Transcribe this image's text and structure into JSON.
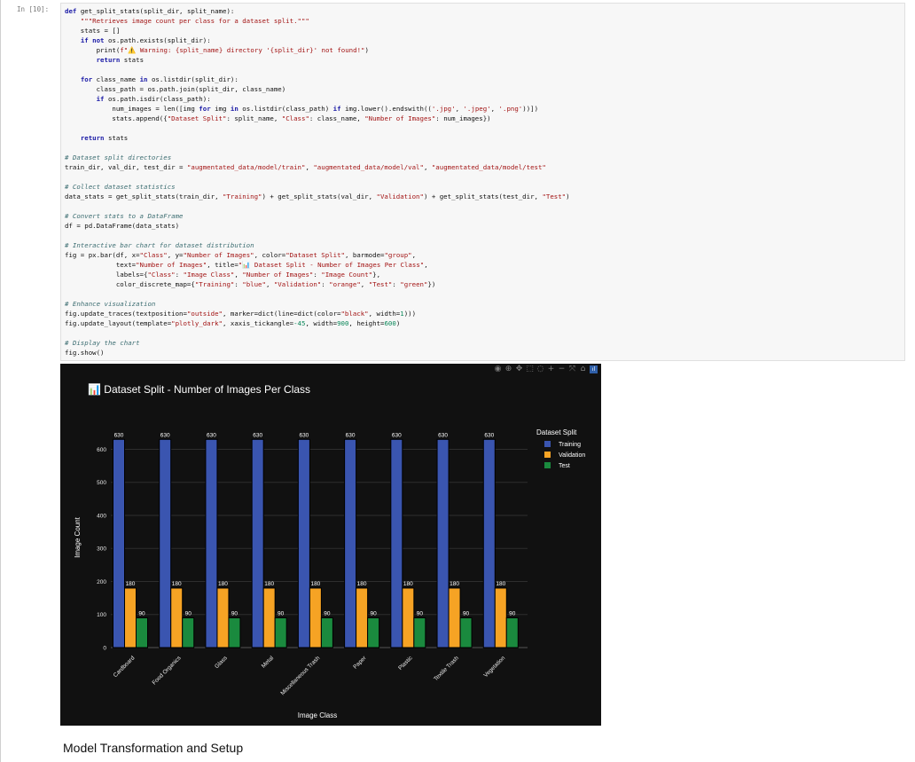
{
  "cell": {
    "prompt": "In [10]:",
    "code_lines": [
      [
        {
          "t": "def ",
          "c": "kw"
        },
        {
          "t": "get_split_stats(split_dir, split_name):",
          "c": "p"
        }
      ],
      [
        {
          "t": "    \"\"\"Retrieves image count per class for a dataset split.\"\"\"",
          "c": "str"
        }
      ],
      [
        {
          "t": "    stats = []",
          "c": "p"
        }
      ],
      [
        {
          "t": "    ",
          "c": "p"
        },
        {
          "t": "if not ",
          "c": "kw"
        },
        {
          "t": "os.path.exists(split_dir):",
          "c": "p"
        }
      ],
      [
        {
          "t": "        print(",
          "c": "p"
        },
        {
          "t": "f\"⚠️ Warning: {split_name} directory '{split_dir}' not found!\"",
          "c": "str"
        },
        {
          "t": ")",
          "c": "p"
        }
      ],
      [
        {
          "t": "        ",
          "c": "p"
        },
        {
          "t": "return ",
          "c": "kw"
        },
        {
          "t": "stats",
          "c": "p"
        }
      ],
      [
        {
          "t": "",
          "c": "p"
        }
      ],
      [
        {
          "t": "    ",
          "c": "p"
        },
        {
          "t": "for ",
          "c": "kw"
        },
        {
          "t": "class_name ",
          "c": "p"
        },
        {
          "t": "in ",
          "c": "kw"
        },
        {
          "t": "os.listdir(split_dir):",
          "c": "p"
        }
      ],
      [
        {
          "t": "        class_path = os.path.join(split_dir, class_name)",
          "c": "p"
        }
      ],
      [
        {
          "t": "        ",
          "c": "p"
        },
        {
          "t": "if ",
          "c": "kw"
        },
        {
          "t": "os.path.isdir(class_path):",
          "c": "p"
        }
      ],
      [
        {
          "t": "            num_images = len([img ",
          "c": "p"
        },
        {
          "t": "for ",
          "c": "kw"
        },
        {
          "t": "img ",
          "c": "p"
        },
        {
          "t": "in ",
          "c": "kw"
        },
        {
          "t": "os.listdir(class_path) ",
          "c": "p"
        },
        {
          "t": "if ",
          "c": "kw"
        },
        {
          "t": "img.lower().endswith((",
          "c": "p"
        },
        {
          "t": "'.jpg'",
          "c": "str"
        },
        {
          "t": ", ",
          "c": "p"
        },
        {
          "t": "'.jpeg'",
          "c": "str"
        },
        {
          "t": ", ",
          "c": "p"
        },
        {
          "t": "'.png'",
          "c": "str"
        },
        {
          "t": "))])",
          "c": "p"
        }
      ],
      [
        {
          "t": "            stats.append({",
          "c": "p"
        },
        {
          "t": "\"Dataset Split\"",
          "c": "str"
        },
        {
          "t": ": split_name, ",
          "c": "p"
        },
        {
          "t": "\"Class\"",
          "c": "str"
        },
        {
          "t": ": class_name, ",
          "c": "p"
        },
        {
          "t": "\"Number of Images\"",
          "c": "str"
        },
        {
          "t": ": num_images})",
          "c": "p"
        }
      ],
      [
        {
          "t": "",
          "c": "p"
        }
      ],
      [
        {
          "t": "    ",
          "c": "p"
        },
        {
          "t": "return ",
          "c": "kw"
        },
        {
          "t": "stats",
          "c": "p"
        }
      ],
      [
        {
          "t": "",
          "c": "p"
        }
      ],
      [
        {
          "t": "# Dataset split directories",
          "c": "cm"
        }
      ],
      [
        {
          "t": "train_dir, val_dir, test_dir = ",
          "c": "p"
        },
        {
          "t": "\"augmentated_data/model/train\"",
          "c": "str"
        },
        {
          "t": ", ",
          "c": "p"
        },
        {
          "t": "\"augmentated_data/model/val\"",
          "c": "str"
        },
        {
          "t": ", ",
          "c": "p"
        },
        {
          "t": "\"augmentated_data/model/test\"",
          "c": "str"
        }
      ],
      [
        {
          "t": "",
          "c": "p"
        }
      ],
      [
        {
          "t": "# Collect dataset statistics",
          "c": "cm"
        }
      ],
      [
        {
          "t": "data_stats = get_split_stats(train_dir, ",
          "c": "p"
        },
        {
          "t": "\"Training\"",
          "c": "str"
        },
        {
          "t": ") + get_split_stats(val_dir, ",
          "c": "p"
        },
        {
          "t": "\"Validation\"",
          "c": "str"
        },
        {
          "t": ") + get_split_stats(test_dir, ",
          "c": "p"
        },
        {
          "t": "\"Test\"",
          "c": "str"
        },
        {
          "t": ")",
          "c": "p"
        }
      ],
      [
        {
          "t": "",
          "c": "p"
        }
      ],
      [
        {
          "t": "# Convert stats to a DataFrame",
          "c": "cm"
        }
      ],
      [
        {
          "t": "df = pd.DataFrame(data_stats)",
          "c": "p"
        }
      ],
      [
        {
          "t": "",
          "c": "p"
        }
      ],
      [
        {
          "t": "# Interactive bar chart for dataset distribution",
          "c": "cm"
        }
      ],
      [
        {
          "t": "fig = px.bar(df, x=",
          "c": "p"
        },
        {
          "t": "\"Class\"",
          "c": "str"
        },
        {
          "t": ", y=",
          "c": "p"
        },
        {
          "t": "\"Number of Images\"",
          "c": "str"
        },
        {
          "t": ", color=",
          "c": "p"
        },
        {
          "t": "\"Dataset Split\"",
          "c": "str"
        },
        {
          "t": ", barmode=",
          "c": "p"
        },
        {
          "t": "\"group\"",
          "c": "str"
        },
        {
          "t": ",",
          "c": "p"
        }
      ],
      [
        {
          "t": "             text=",
          "c": "p"
        },
        {
          "t": "\"Number of Images\"",
          "c": "str"
        },
        {
          "t": ", title=",
          "c": "p"
        },
        {
          "t": "\"📊 Dataset Split - Number of Images Per Class\"",
          "c": "str"
        },
        {
          "t": ",",
          "c": "p"
        }
      ],
      [
        {
          "t": "             labels={",
          "c": "p"
        },
        {
          "t": "\"Class\"",
          "c": "str"
        },
        {
          "t": ": ",
          "c": "p"
        },
        {
          "t": "\"Image Class\"",
          "c": "str"
        },
        {
          "t": ", ",
          "c": "p"
        },
        {
          "t": "\"Number of Images\"",
          "c": "str"
        },
        {
          "t": ": ",
          "c": "p"
        },
        {
          "t": "\"Image Count\"",
          "c": "str"
        },
        {
          "t": "},",
          "c": "p"
        }
      ],
      [
        {
          "t": "             color_discrete_map={",
          "c": "p"
        },
        {
          "t": "\"Training\"",
          "c": "str"
        },
        {
          "t": ": ",
          "c": "p"
        },
        {
          "t": "\"blue\"",
          "c": "str"
        },
        {
          "t": ", ",
          "c": "p"
        },
        {
          "t": "\"Validation\"",
          "c": "str"
        },
        {
          "t": ": ",
          "c": "p"
        },
        {
          "t": "\"orange\"",
          "c": "str"
        },
        {
          "t": ", ",
          "c": "p"
        },
        {
          "t": "\"Test\"",
          "c": "str"
        },
        {
          "t": ": ",
          "c": "p"
        },
        {
          "t": "\"green\"",
          "c": "str"
        },
        {
          "t": "})",
          "c": "p"
        }
      ],
      [
        {
          "t": "",
          "c": "p"
        }
      ],
      [
        {
          "t": "# Enhance visualization",
          "c": "cm"
        }
      ],
      [
        {
          "t": "fig.update_traces(textposition=",
          "c": "p"
        },
        {
          "t": "\"outside\"",
          "c": "str"
        },
        {
          "t": ", marker=dict(line=dict(color=",
          "c": "p"
        },
        {
          "t": "\"black\"",
          "c": "str"
        },
        {
          "t": ", width=",
          "c": "p"
        },
        {
          "t": "1",
          "c": "num"
        },
        {
          "t": ")))",
          "c": "p"
        }
      ],
      [
        {
          "t": "fig.update_layout(template=",
          "c": "p"
        },
        {
          "t": "\"plotly_dark\"",
          "c": "str"
        },
        {
          "t": ", xaxis_tickangle=",
          "c": "p"
        },
        {
          "t": "-45",
          "c": "num"
        },
        {
          "t": ", width=",
          "c": "p"
        },
        {
          "t": "900",
          "c": "num"
        },
        {
          "t": ", height=",
          "c": "p"
        },
        {
          "t": "600",
          "c": "num"
        },
        {
          "t": ")",
          "c": "p"
        }
      ],
      [
        {
          "t": "",
          "c": "p"
        }
      ],
      [
        {
          "t": "# Display the chart",
          "c": "cm"
        }
      ],
      [
        {
          "t": "fig.show()",
          "c": "p"
        }
      ]
    ]
  },
  "syntax_colors": {
    "kw": "#1a1aa6",
    "str": "#a31515",
    "cm": "#3d6e72",
    "num": "#098658",
    "p": "#111111"
  },
  "modebar_icons": [
    {
      "name": "camera-icon",
      "glyph": "◉"
    },
    {
      "name": "zoom-icon",
      "glyph": "⊕"
    },
    {
      "name": "pan-icon",
      "glyph": "✥"
    },
    {
      "name": "box-select-icon",
      "glyph": "⬚"
    },
    {
      "name": "lasso-select-icon",
      "glyph": "◌"
    },
    {
      "name": "zoom-in-icon",
      "glyph": "+"
    },
    {
      "name": "zoom-out-icon",
      "glyph": "−"
    },
    {
      "name": "autoscale-icon",
      "glyph": "⤧"
    },
    {
      "name": "reset-axes-icon",
      "glyph": "⌂"
    },
    {
      "name": "plotly-logo-icon",
      "glyph": "ıl"
    }
  ],
  "chart_data": {
    "type": "bar",
    "title": "📊 Dataset Split - Number of Images Per Class",
    "xlabel": "Image Class",
    "ylabel": "Image Count",
    "categories": [
      "Cardboard",
      "Food Organics",
      "Glass",
      "Metal",
      "Miscellaneous Trash",
      "Paper",
      "Plastic",
      "Textile Trash",
      "Vegetation"
    ],
    "series": [
      {
        "name": "Training",
        "color": "#3a55b0",
        "values": [
          630,
          630,
          630,
          630,
          630,
          630,
          630,
          630,
          630
        ]
      },
      {
        "name": "Validation",
        "color": "#f6a324",
        "values": [
          180,
          180,
          180,
          180,
          180,
          180,
          180,
          180,
          180
        ]
      },
      {
        "name": "Test",
        "color": "#1a8a3e",
        "values": [
          90,
          90,
          90,
          90,
          90,
          90,
          90,
          90,
          90
        ]
      }
    ],
    "ylim": [
      0,
      663
    ],
    "yticks": [
      0,
      100,
      200,
      300,
      400,
      500,
      600
    ],
    "legend_title": "Dataset Split",
    "legend_position": "right",
    "x_tick_angle": -45,
    "grid": true,
    "template": "plotly_dark"
  },
  "section_heading": "Model Transformation and Setup"
}
